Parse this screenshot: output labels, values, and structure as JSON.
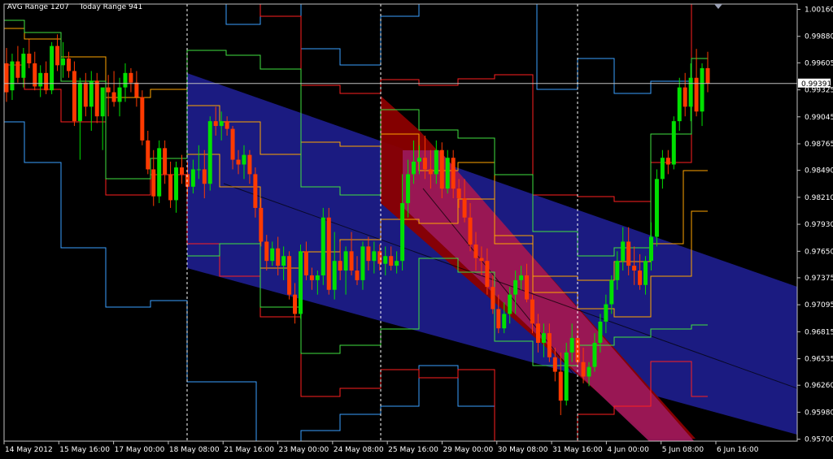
{
  "info": {
    "avg_range_label": "AVG Range 1207",
    "today_range_label": "Today Range 941"
  },
  "colors": {
    "background": "#000000",
    "frame": "#c0c0c0",
    "bull_candle": "#00e000",
    "bear_candle": "#ff3a00",
    "channel_outer": "#1c1c84",
    "channel_inner": "#9a1858",
    "channel_red": "#8b0000",
    "axis_text": "#ffffff"
  },
  "chart_data": {
    "type": "candlestick",
    "symbol_range_labels": [
      "AVG Range 1207",
      "Today Range 941"
    ],
    "price_ticks": [
      "1.00160",
      "0.99880",
      "0.99605",
      "0.99325",
      "0.99045",
      "0.98765",
      "0.98490",
      "0.98210",
      "0.97930",
      "0.97650",
      "0.97375",
      "0.97095",
      "0.96815",
      "0.96535",
      "0.96260",
      "0.95980",
      "0.95700"
    ],
    "ylim": [
      0.9568,
      1.00215
    ],
    "current_price": "0.99391",
    "time_labels": [
      "14 May 2012",
      "15 May 16:00",
      "17 May 00:00",
      "18 May 08:00",
      "21 May 16:00",
      "23 May 00:00",
      "24 May 08:00",
      "25 May 16:00",
      "29 May 00:00",
      "30 May 08:00",
      "31 May 16:00",
      "4 Jun 00:00",
      "5 Jun 08:00",
      "6 Jun 16:00"
    ],
    "day_separators": [
      "18 May 08:00",
      "25 May 16:00",
      "4 Jun 00:00"
    ],
    "candles": [
      [
        0.996,
        0.9976,
        0.992,
        0.993
      ],
      [
        0.9932,
        0.997,
        0.9922,
        0.9962
      ],
      [
        0.9962,
        0.9978,
        0.994,
        0.9945
      ],
      [
        0.9945,
        0.9976,
        0.9935,
        0.997
      ],
      [
        0.997,
        0.9985,
        0.9955,
        0.996
      ],
      [
        0.996,
        0.9972,
        0.9932,
        0.9936
      ],
      [
        0.9936,
        0.9958,
        0.9925,
        0.995
      ],
      [
        0.995,
        0.9962,
        0.9928,
        0.9932
      ],
      [
        0.9932,
        0.9982,
        0.9928,
        0.9978
      ],
      [
        0.9978,
        0.999,
        0.9952,
        0.9958
      ],
      [
        0.9958,
        0.9982,
        0.9945,
        0.9965
      ],
      [
        0.9965,
        0.9972,
        0.9945,
        0.9952
      ],
      [
        0.9952,
        0.9962,
        0.9895,
        0.99
      ],
      [
        0.99,
        0.9945,
        0.986,
        0.994
      ],
      [
        0.994,
        0.995,
        0.9905,
        0.9915
      ],
      [
        0.9915,
        0.9952,
        0.989,
        0.9942
      ],
      [
        0.9942,
        0.995,
        0.9898,
        0.9905
      ],
      [
        0.9905,
        0.992,
        0.987,
        0.9935
      ],
      [
        0.9935,
        0.9948,
        0.9905,
        0.993
      ],
      [
        0.993,
        0.9952,
        0.9915,
        0.992
      ],
      [
        0.992,
        0.9945,
        0.9905,
        0.9935
      ],
      [
        0.9935,
        0.996,
        0.992,
        0.995
      ],
      [
        0.995,
        0.9955,
        0.993,
        0.994
      ],
      [
        0.994,
        0.9952,
        0.9915,
        0.9925
      ],
      [
        0.9925,
        0.9932,
        0.9875,
        0.988
      ],
      [
        0.988,
        0.989,
        0.9845,
        0.985
      ],
      [
        0.985,
        0.987,
        0.9812,
        0.9822
      ],
      [
        0.9822,
        0.988,
        0.9815,
        0.9872
      ],
      [
        0.9872,
        0.988,
        0.9835,
        0.9845
      ],
      [
        0.9845,
        0.9858,
        0.981,
        0.9818
      ],
      [
        0.9818,
        0.9858,
        0.9805,
        0.9852
      ],
      [
        0.9852,
        0.9865,
        0.9835,
        0.9845
      ],
      [
        0.9845,
        0.9858,
        0.9822,
        0.9832
      ],
      [
        0.9832,
        0.986,
        0.9825,
        0.985
      ],
      [
        0.985,
        0.9875,
        0.984,
        0.985
      ],
      [
        0.985,
        0.987,
        0.982,
        0.9835
      ],
      [
        0.9835,
        0.9905,
        0.9828,
        0.99
      ],
      [
        0.99,
        0.9915,
        0.9885,
        0.9895
      ],
      [
        0.9895,
        0.991,
        0.988,
        0.99
      ],
      [
        0.99,
        0.9905,
        0.9885,
        0.9892
      ],
      [
        0.9892,
        0.9895,
        0.985,
        0.986
      ],
      [
        0.986,
        0.987,
        0.9845,
        0.9855
      ],
      [
        0.9855,
        0.9875,
        0.984,
        0.9865
      ],
      [
        0.9865,
        0.987,
        0.9835,
        0.9845
      ],
      [
        0.9845,
        0.9852,
        0.98,
        0.981
      ],
      [
        0.981,
        0.982,
        0.977,
        0.9775
      ],
      [
        0.9775,
        0.9782,
        0.9745,
        0.9755
      ],
      [
        0.9755,
        0.9775,
        0.975,
        0.9768
      ],
      [
        0.9768,
        0.978,
        0.974,
        0.975
      ],
      [
        0.975,
        0.977,
        0.9735,
        0.976
      ],
      [
        0.976,
        0.9765,
        0.9715,
        0.972
      ],
      [
        0.972,
        0.9732,
        0.969,
        0.97
      ],
      [
        0.97,
        0.9772,
        0.9695,
        0.9765
      ],
      [
        0.9765,
        0.9775,
        0.9735,
        0.974
      ],
      [
        0.974,
        0.9748,
        0.9725,
        0.9735
      ],
      [
        0.9735,
        0.9745,
        0.972,
        0.974
      ],
      [
        0.974,
        0.981,
        0.973,
        0.98
      ],
      [
        0.98,
        0.981,
        0.972,
        0.9725
      ],
      [
        0.9725,
        0.9785,
        0.9715,
        0.9755
      ],
      [
        0.9755,
        0.9775,
        0.9735,
        0.9745
      ],
      [
        0.9745,
        0.977,
        0.972,
        0.9765
      ],
      [
        0.9765,
        0.9785,
        0.974,
        0.9745
      ],
      [
        0.9745,
        0.976,
        0.973,
        0.9735
      ],
      [
        0.9735,
        0.9775,
        0.9725,
        0.977
      ],
      [
        0.977,
        0.978,
        0.9745,
        0.9755
      ],
      [
        0.9755,
        0.9775,
        0.9742,
        0.9765
      ],
      [
        0.9765,
        0.9772,
        0.9745,
        0.9752
      ],
      [
        0.9752,
        0.977,
        0.974,
        0.976
      ],
      [
        0.976,
        0.977,
        0.9745,
        0.975
      ],
      [
        0.975,
        0.9765,
        0.9742,
        0.9755
      ],
      [
        0.9755,
        0.9845,
        0.9745,
        0.9815
      ],
      [
        0.9815,
        0.986,
        0.98,
        0.9845
      ],
      [
        0.9845,
        0.988,
        0.9835,
        0.9858
      ],
      [
        0.9858,
        0.9875,
        0.9845,
        0.9862
      ],
      [
        0.9862,
        0.9885,
        0.984,
        0.985
      ],
      [
        0.985,
        0.987,
        0.983,
        0.9845
      ],
      [
        0.9845,
        0.988,
        0.9835,
        0.987
      ],
      [
        0.987,
        0.9878,
        0.982,
        0.983
      ],
      [
        0.983,
        0.987,
        0.9825,
        0.9862
      ],
      [
        0.9862,
        0.987,
        0.982,
        0.983
      ],
      [
        0.983,
        0.984,
        0.981,
        0.982
      ],
      [
        0.982,
        0.984,
        0.9795,
        0.98
      ],
      [
        0.98,
        0.9815,
        0.9765,
        0.9772
      ],
      [
        0.9772,
        0.9785,
        0.9745,
        0.9758
      ],
      [
        0.9758,
        0.977,
        0.974,
        0.9755
      ],
      [
        0.9755,
        0.9768,
        0.972,
        0.9728
      ],
      [
        0.9728,
        0.974,
        0.97,
        0.9705
      ],
      [
        0.9705,
        0.972,
        0.968,
        0.9685
      ],
      [
        0.9685,
        0.9712,
        0.968,
        0.97
      ],
      [
        0.97,
        0.9728,
        0.969,
        0.972
      ],
      [
        0.972,
        0.9745,
        0.97,
        0.9735
      ],
      [
        0.9735,
        0.975,
        0.9725,
        0.974
      ],
      [
        0.974,
        0.9752,
        0.9712,
        0.9715
      ],
      [
        0.9715,
        0.972,
        0.968,
        0.969
      ],
      [
        0.969,
        0.97,
        0.966,
        0.967
      ],
      [
        0.967,
        0.969,
        0.9655,
        0.968
      ],
      [
        0.968,
        0.969,
        0.965,
        0.9655
      ],
      [
        0.9655,
        0.9665,
        0.963,
        0.964
      ],
      [
        0.964,
        0.966,
        0.9595,
        0.961
      ],
      [
        0.961,
        0.967,
        0.9605,
        0.966
      ],
      [
        0.966,
        0.969,
        0.965,
        0.9675
      ],
      [
        0.9675,
        0.9685,
        0.9645,
        0.965
      ],
      [
        0.965,
        0.9665,
        0.9628,
        0.9635
      ],
      [
        0.9635,
        0.965,
        0.9625,
        0.9645
      ],
      [
        0.9645,
        0.968,
        0.964,
        0.967
      ],
      [
        0.967,
        0.97,
        0.966,
        0.9692
      ],
      [
        0.9692,
        0.972,
        0.968,
        0.971
      ],
      [
        0.971,
        0.974,
        0.97,
        0.9735
      ],
      [
        0.9735,
        0.9765,
        0.9725,
        0.9755
      ],
      [
        0.9755,
        0.979,
        0.9745,
        0.9775
      ],
      [
        0.9775,
        0.979,
        0.974,
        0.975
      ],
      [
        0.975,
        0.977,
        0.973,
        0.9745
      ],
      [
        0.9745,
        0.9762,
        0.9725,
        0.973
      ],
      [
        0.973,
        0.976,
        0.972,
        0.9755
      ],
      [
        0.9755,
        0.9795,
        0.9745,
        0.978
      ],
      [
        0.978,
        0.985,
        0.977,
        0.984
      ],
      [
        0.984,
        0.987,
        0.983,
        0.9862
      ],
      [
        0.9862,
        0.987,
        0.9845,
        0.9855
      ],
      [
        0.9855,
        0.9905,
        0.985,
        0.99
      ],
      [
        0.99,
        0.9945,
        0.989,
        0.9935
      ],
      [
        0.9935,
        0.995,
        0.9905,
        0.9915
      ],
      [
        0.9915,
        0.996,
        0.99,
        0.9945
      ],
      [
        0.9945,
        0.9975,
        0.9905,
        0.991
      ],
      [
        0.991,
        0.996,
        0.9895,
        0.9955
      ],
      [
        0.9955,
        0.9972,
        0.993,
        0.9939
      ]
    ]
  }
}
